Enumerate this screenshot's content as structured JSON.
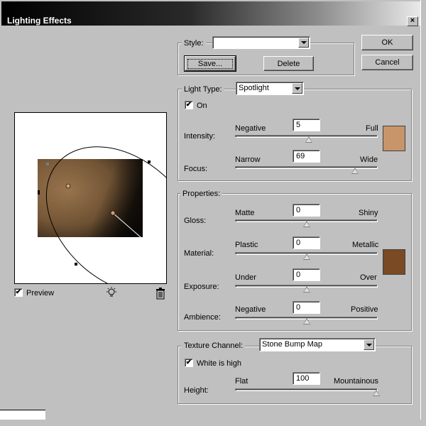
{
  "window": {
    "title": "Lighting Effects",
    "close_glyph": "×"
  },
  "buttons": {
    "ok": "OK",
    "cancel": "Cancel",
    "save": "Save...",
    "delete": "Delete"
  },
  "style": {
    "label": "Style:",
    "value": ""
  },
  "light": {
    "type_label": "Light Type:",
    "type_value": "Spotlight",
    "on_label": "On",
    "on_checked": true,
    "intensity": {
      "label": "Intensity:",
      "min_label": "Negative",
      "max_label": "Full",
      "value": "5",
      "fraction": 0.52
    },
    "focus": {
      "label": "Focus:",
      "min_label": "Narrow",
      "max_label": "Wide",
      "value": "69",
      "fraction": 0.85
    },
    "color": "#c8956a"
  },
  "properties": {
    "label": "Properties:",
    "gloss": {
      "label": "Gloss:",
      "min_label": "Matte",
      "max_label": "Shiny",
      "value": "0",
      "fraction": 0.5
    },
    "material": {
      "label": "Material:",
      "min_label": "Plastic",
      "max_label": "Metallic",
      "value": "0",
      "fraction": 0.5
    },
    "exposure": {
      "label": "Exposure:",
      "min_label": "Under",
      "max_label": "Over",
      "value": "0",
      "fraction": 0.5
    },
    "ambience": {
      "label": "Ambience:",
      "min_label": "Negative",
      "max_label": "Positive",
      "value": "0",
      "fraction": 0.5
    },
    "color": "#7a4a24"
  },
  "texture": {
    "channel_label": "Texture Channel:",
    "channel_value": "Stone Bump Map",
    "white_high_label": "White is high",
    "white_high_checked": true,
    "height": {
      "label": "Height:",
      "min_label": "Flat",
      "max_label": "Mountainous",
      "value": "100",
      "fraction": 1.0
    }
  },
  "preview": {
    "label": "Preview",
    "checked": true,
    "light_icon": "lightbulb-icon",
    "trash_icon": "trash-icon"
  }
}
